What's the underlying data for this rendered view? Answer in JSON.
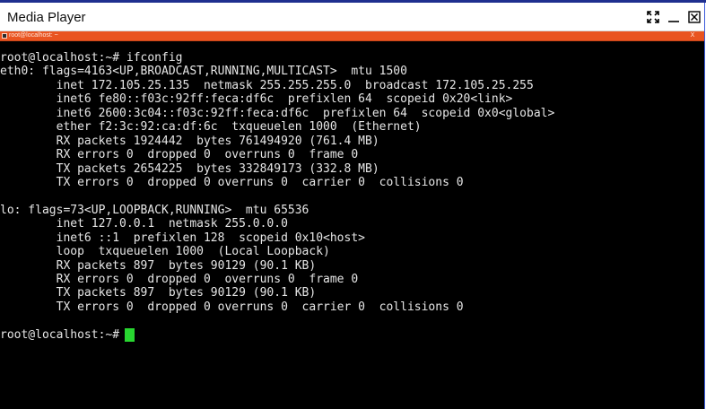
{
  "window": {
    "title": "Media Player"
  },
  "inner_window": {
    "title": "root@localhost: ~",
    "close_glyph": "X"
  },
  "terminal": {
    "lines": [
      "root@localhost:~# ifconfig",
      "eth0: flags=4163<UP,BROADCAST,RUNNING,MULTICAST>  mtu 1500",
      "        inet 172.105.25.135  netmask 255.255.255.0  broadcast 172.105.25.255",
      "        inet6 fe80::f03c:92ff:feca:df6c  prefixlen 64  scopeid 0x20<link>",
      "        inet6 2600:3c04::f03c:92ff:feca:df6c  prefixlen 64  scopeid 0x0<global>",
      "        ether f2:3c:92:ca:df:6c  txqueuelen 1000  (Ethernet)",
      "        RX packets 1924442  bytes 761494920 (761.4 MB)",
      "        RX errors 0  dropped 0  overruns 0  frame 0",
      "        TX packets 2654225  bytes 332849173 (332.8 MB)",
      "        TX errors 0  dropped 0 overruns 0  carrier 0  collisions 0",
      "",
      "lo: flags=73<UP,LOOPBACK,RUNNING>  mtu 65536",
      "        inet 127.0.0.1  netmask 255.0.0.0",
      "        inet6 ::1  prefixlen 128  scopeid 0x10<host>",
      "        loop  txqueuelen 1000  (Local Loopback)",
      "        RX packets 897  bytes 90129 (90.1 KB)",
      "        RX errors 0  dropped 0  overruns 0  frame 0",
      "        TX packets 897  bytes 90129 (90.1 KB)",
      "        TX errors 0  dropped 0 overruns 0  carrier 0  collisions 0",
      ""
    ],
    "prompt": "root@localhost:~#",
    "colors": {
      "background": "#000000",
      "text": "#e6e6e6",
      "cursor": "#28d630",
      "inner_bar": "#e95420"
    }
  },
  "icons": {
    "expand": "expand-icon",
    "minimize": "minimize-icon",
    "close": "close-icon"
  }
}
